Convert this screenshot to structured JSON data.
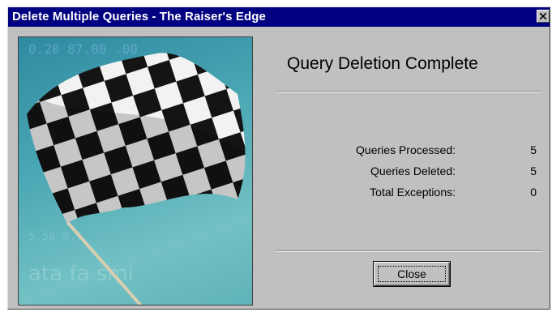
{
  "window": {
    "title": "Delete Multiple Queries - The Raiser's Edge"
  },
  "picture": {
    "description_icon": "checkered-flag"
  },
  "main": {
    "heading": "Query Deletion Complete",
    "stats": [
      {
        "label": "Queries Processed:",
        "value": "5"
      },
      {
        "label": "Queries Deleted:",
        "value": "5"
      },
      {
        "label": "Total Exceptions:",
        "value": "0"
      }
    ],
    "close_label": "Close"
  },
  "colors": {
    "titlebar": "#000080",
    "face": "#c0c0c0"
  }
}
